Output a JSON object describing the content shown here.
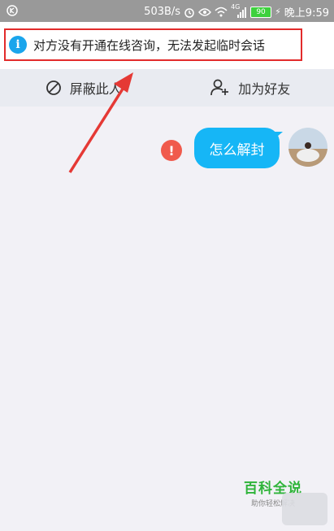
{
  "status_bar": {
    "speed": "503B/s",
    "network": "4G",
    "battery_level": "90",
    "time": "晚上9:59"
  },
  "notice": {
    "text": "对方没有开通在线咨询，无法发起临时会话",
    "icon": "info-icon"
  },
  "actions": {
    "block_label": "屏蔽此人",
    "add_friend_label": "加为好友"
  },
  "chat": {
    "message": "怎么解封",
    "status": "send-failed"
  },
  "watermark": {
    "title": "百科全说",
    "subtitle": "助你轻松解决"
  },
  "colors": {
    "bubble": "#16b6f6",
    "highlight": "#e22b2b",
    "error": "#f05a4c",
    "info": "#1aa5ec"
  }
}
